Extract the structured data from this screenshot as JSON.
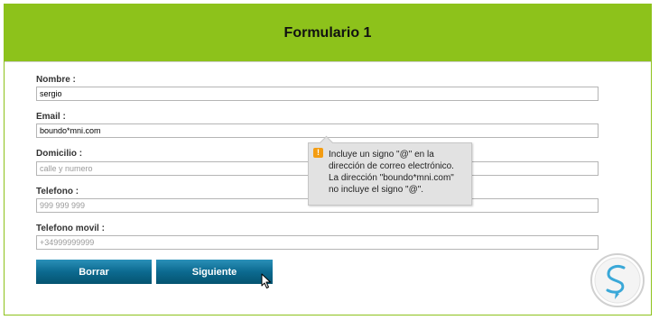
{
  "form": {
    "title": "Formulario 1",
    "fields": [
      {
        "label": "Nombre :",
        "value": "sergio",
        "placeholder": ""
      },
      {
        "label": "Email :",
        "value": "boundo*mni.com",
        "placeholder": ""
      },
      {
        "label": "Domicilio :",
        "value": "",
        "placeholder": "calle y numero"
      },
      {
        "label": "Telefono :",
        "value": "",
        "placeholder": "999 999 999"
      },
      {
        "label": "Telefono movil :",
        "value": "",
        "placeholder": "+34999999999"
      }
    ],
    "buttons": {
      "clear_label": "Borrar",
      "next_label": "Siguiente"
    }
  },
  "validation_tooltip": {
    "icon": "warning-icon",
    "icon_glyph": "!",
    "lines": [
      "Incluye un signo \"@\" en la",
      "dirección de correo electrónico.",
      "La dirección \"boundo*mni.com\"",
      "no incluye el signo \"@\"."
    ]
  },
  "colors": {
    "header_bg": "#8dc21b",
    "button_bg": "#0c6a90",
    "warning": "#f39c12",
    "logo": "#3aa8d8"
  },
  "logo": {
    "icon": "solvetic-logo-icon"
  },
  "cursor": {
    "icon": "mouse-pointer-icon"
  }
}
